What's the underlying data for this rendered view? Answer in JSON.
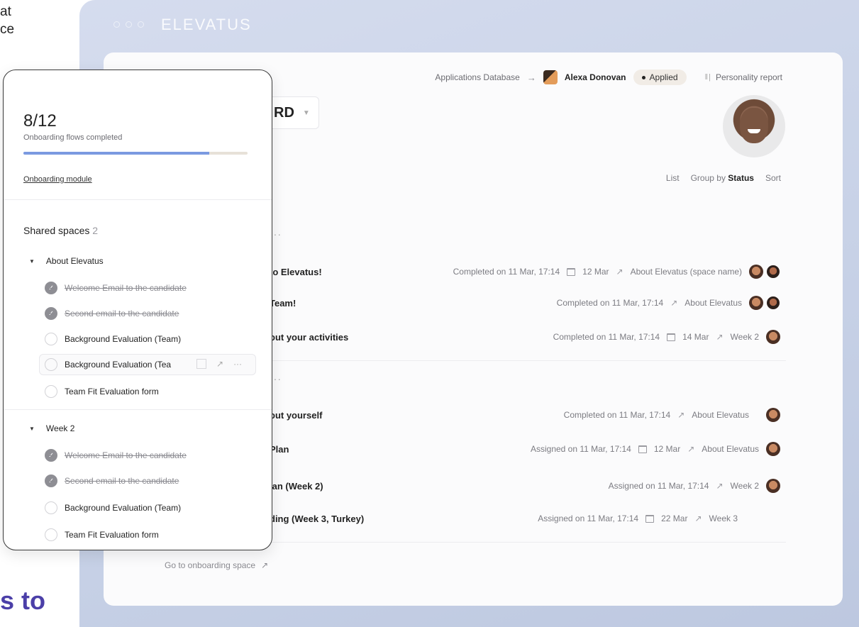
{
  "background": {
    "top_text_lines": [
      "at",
      "ce"
    ],
    "bottom_text": "s to"
  },
  "app": {
    "logo": "ELEVATUS"
  },
  "header": {
    "breadcrumb_db": "Applications Database",
    "candidate_name": "Alexa Donovan",
    "status": "Applied",
    "personality_report": "Personality report",
    "title_fragment": "RD"
  },
  "view": {
    "list": "List",
    "group_by": "Group by",
    "group_by_value": "Status",
    "sort": "Sort"
  },
  "rows_group1": [
    {
      "title": "to Elevatus!",
      "status": "Completed on 11 Mar, 17:14",
      "due": "12 Mar",
      "space": "About Elevatus (space name)",
      "avatars": 2
    },
    {
      "title": "Team!",
      "status": "Completed on 11 Mar, 17:14",
      "due": "",
      "space": "About Elevatus",
      "avatars": 2
    },
    {
      "title": "out your activities",
      "status": "Completed on 11 Mar, 17:14",
      "due": "14 Mar",
      "space": "Week 2",
      "avatars": 1
    }
  ],
  "rows_group2": [
    {
      "title": "out yourself",
      "status": "Completed on 11 Mar, 17:14",
      "due": "",
      "space": "About Elevatus",
      "avatars": 1
    },
    {
      "title": "Plan",
      "status": "Assigned on 11 Mar, 17:14",
      "due": "12 Mar",
      "space": "About Elevatus",
      "avatars": 1
    },
    {
      "title": "lan (Week 2)",
      "status": "Assigned on 11 Mar, 17:14",
      "due": "",
      "space": "Week 2",
      "avatars": 1
    },
    {
      "title": "ding (Week 3, Turkey)",
      "status": "Assigned on 11 Mar, 17:14",
      "due": "22 Mar",
      "space": "Week 3",
      "avatars": 0
    }
  ],
  "footer": {
    "goto": "Go to onboarding space"
  },
  "panel": {
    "count": "8/12",
    "count_label": "Onboarding flows completed",
    "progress": 0.83,
    "module_link": "Onboarding module",
    "shared_title": "Shared spaces",
    "shared_count": "2",
    "folders": [
      {
        "name": "About Elevatus",
        "tasks": [
          {
            "label": "Welcome Email to the candidate",
            "done": true
          },
          {
            "label": "Second email to the candidate",
            "done": true
          },
          {
            "label": "Background Evaluation (Team)",
            "done": false
          },
          {
            "label": "Background Evaluation (Tea",
            "done": false
          },
          {
            "label": "Team Fit Evaluation form",
            "done": false
          }
        ]
      },
      {
        "name": "Week 2",
        "tasks": [
          {
            "label": "Welcome Email to the candidate",
            "done": true
          },
          {
            "label": "Second email to the candidate",
            "done": true
          },
          {
            "label": "Background Evaluation (Team)",
            "done": false
          },
          {
            "label": "Team Fit Evaluation form",
            "done": false
          }
        ]
      }
    ]
  }
}
